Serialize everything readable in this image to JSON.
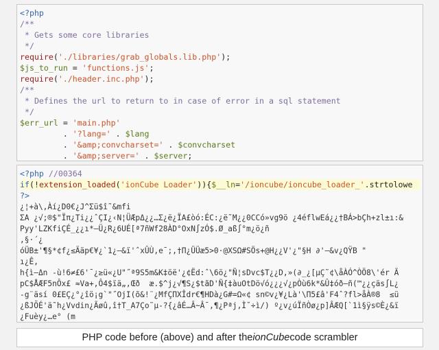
{
  "before_code": {
    "lines": [
      {
        "segments": [
          {
            "t": "<?php",
            "c": "kw"
          }
        ]
      },
      {
        "segments": [
          {
            "t": "/**",
            "c": "cm"
          }
        ]
      },
      {
        "segments": [
          {
            "t": " * Gets some core libraries",
            "c": "cm"
          }
        ]
      },
      {
        "segments": [
          {
            "t": " */",
            "c": "cm"
          }
        ]
      },
      {
        "segments": [
          {
            "t": "require",
            "c": "fn"
          },
          {
            "t": "(",
            "c": "pl"
          },
          {
            "t": "'./libraries/grab_globals.lib.php'",
            "c": "st"
          },
          {
            "t": ");",
            "c": "pl"
          }
        ]
      },
      {
        "segments": [
          {
            "t": "$js_to_run",
            "c": "var"
          },
          {
            "t": " = ",
            "c": "pl"
          },
          {
            "t": "'functions.js'",
            "c": "st"
          },
          {
            "t": ";",
            "c": "pl"
          }
        ]
      },
      {
        "segments": [
          {
            "t": "require",
            "c": "fn"
          },
          {
            "t": "(",
            "c": "pl"
          },
          {
            "t": "'./header.inc.php'",
            "c": "st"
          },
          {
            "t": ");",
            "c": "pl"
          }
        ]
      },
      {
        "segments": [
          {
            "t": "/**",
            "c": "cm"
          }
        ]
      },
      {
        "segments": [
          {
            "t": " * Defines the url to return to in case of error in a sql statement",
            "c": "cm"
          }
        ]
      },
      {
        "segments": [
          {
            "t": " */",
            "c": "cm"
          }
        ]
      },
      {
        "segments": [
          {
            "t": "$err_url",
            "c": "var"
          },
          {
            "t": " = ",
            "c": "pl"
          },
          {
            "t": "'main.php'",
            "c": "st"
          }
        ]
      },
      {
        "segments": [
          {
            "t": "         . ",
            "c": "pl"
          },
          {
            "t": "'?lang='",
            "c": "st"
          },
          {
            "t": " . ",
            "c": "pl"
          },
          {
            "t": "$lang",
            "c": "var"
          }
        ]
      },
      {
        "segments": [
          {
            "t": "         . ",
            "c": "pl"
          },
          {
            "t": "'&amp;convcharset='",
            "c": "st"
          },
          {
            "t": " . ",
            "c": "pl"
          },
          {
            "t": "$convcharset",
            "c": "var"
          }
        ]
      },
      {
        "segments": [
          {
            "t": "         . ",
            "c": "pl"
          },
          {
            "t": "'&amp;server='",
            "c": "st"
          },
          {
            "t": " . ",
            "c": "pl"
          },
          {
            "t": "$server",
            "c": "var"
          },
          {
            "t": ";",
            "c": "pl"
          }
        ]
      }
    ]
  },
  "after_code": {
    "lines": [
      {
        "segments": [
          {
            "t": "<?php ",
            "c": "kw"
          },
          {
            "t": "//00364",
            "c": "cm"
          }
        ]
      },
      {
        "hl": true,
        "segments": [
          {
            "t": "if",
            "c": "kw"
          },
          {
            "t": "(!",
            "c": "pl"
          },
          {
            "t": "extension_loaded",
            "c": "fn"
          },
          {
            "t": "(",
            "c": "pl"
          },
          {
            "t": "'ionCube Loader'",
            "c": "st"
          },
          {
            "t": ")){",
            "c": "pl"
          },
          {
            "t": "$__ln",
            "c": "var"
          },
          {
            "t": "=",
            "c": "pl"
          },
          {
            "t": "'/ioncube/ioncube_loader_'",
            "c": "st"
          },
          {
            "t": ".strtolowe",
            "c": "pl"
          }
        ]
      },
      {
        "segments": [
          {
            "t": "?>",
            "c": "kw"
          }
        ]
      },
      {
        "segments": [
          {
            "t": "¿¦+à\\‚Àí¿D0€¿J^Σü$î˜&mfi",
            "c": "scr"
          }
        ]
      },
      {
        "segments": [
          {
            "t": "ΣA ¿√;®$\"Ïπ¿Ti¿¿ˆÇI¿‹N¦ÜÆpΔ¿¿…Σ¿ë¿ÏA£òó:ÉC:¿ë˜M¿¿0CCó»vg9ö ¿4éflwEá¿¿†BÁ>bÇh+zl±ı:&",
            "c": "scr"
          }
        ]
      },
      {
        "segments": [
          {
            "t": "Pyy'LZKfiÇÉ_¿¿ı*–Ü¿R¿6UÉ[ª7ñWf28ÀD°OxN∫zÓ$.Ø_aß∫°m¿ö¿ñ",
            "c": "scr"
          }
        ]
      },
      {
        "segments": [
          {
            "t": ",§·´¿",
            "c": "scr"
          }
        ]
      },
      {
        "segments": [
          {
            "t": "óÜB±'¶§*¢f¿≤Ääp€¥¿`1¿–&ï'ˆxÛÙ,e¯;,†Π¿ÜÜæ5>0·@XSΩ#SÖs+@H¿¿V'¿\"§H ∂'–&v¿QŸB \"",
            "c": "scr"
          }
        ]
      },
      {
        "segments": [
          {
            "t": "ı¿Ê,",
            "c": "scr"
          }
        ]
      },
      {
        "segments": [
          {
            "t": "h{ì–Δn -ù!6≠£6'¯¿≥ü«¿U\"˝ª9S5m&K‡öë'¿¢Ëd:ˆ\\6ö¿\"Ñ¦sDvc$T¿¿D,»(∂_¿[µÇ˜¢\\åÀÓ^ÒÖ8\\'ér Ã",
            "c": "scr"
          }
        ]
      },
      {
        "segments": [
          {
            "t": "pC$ÅÆF5nÔx£ ≈Va+,Ô4$ïä„,Œð  æ.$^j¿√¶S¿$tãD'Ñ{‡àuOtDö√ó¿¿¿√¿pÒù6k*&Û‡óð–ñ(™¿¿çäs∫L¿",
            "c": "scr"
          }
        ]
      },
      {
        "segments": [
          {
            "t": "-g¨äsí 0£EÇ¿°¿îö¡g`\"˝OjI(õ&!¨¿MfÇΠXÎdr€¶HDà¿G#=Ω«¢ sn©v¿¥¿Là'\\Π5£â'F4ˆ?fl>åÀ®8  ≤ü",
            "c": "scr"
          }
        ]
      },
      {
        "segments": [
          {
            "t": "¿ßJÕÉ'ä˜h¿Vvdin¿Ãøû,î†T_A7Ço˜µ-?{¿âÉ…Â~Â¯,¶¿Pªj,Ì˘÷ì/) º¿v¿úÏñÒø¿p]ÂÆQ[`1ì§ÿs©È¿&ï",
            "c": "scr"
          }
        ]
      },
      {
        "segments": [
          {
            "t": "¿Fuèy¿…e° (m",
            "c": "scr"
          }
        ]
      }
    ]
  },
  "caption": {
    "prefix": "PHP code before (above) and after the ",
    "emphasis": "ionCube",
    "suffix": " code scrambler"
  }
}
